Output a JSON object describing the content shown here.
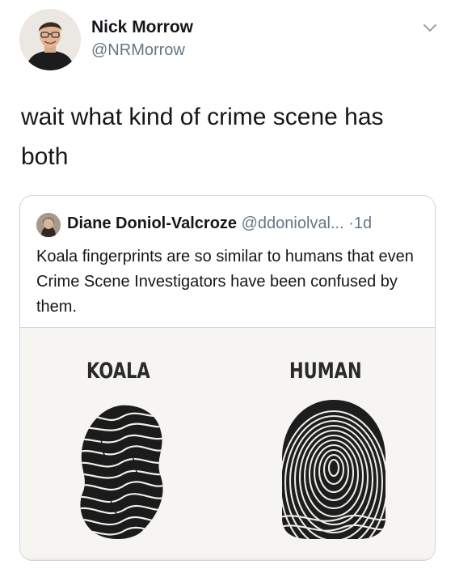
{
  "tweet": {
    "author": {
      "display_name": "Nick Morrow",
      "handle": "@NRMorrow",
      "avatar_icon": "profile-photo"
    },
    "menu_icon": "chevron-down-icon",
    "text": "wait what kind of crime scene has both"
  },
  "quoted_tweet": {
    "author": {
      "display_name": "Diane Doniol-Valcroze",
      "handle": "@ddoniolval...",
      "avatar_icon": "profile-photo"
    },
    "separator": "·",
    "time_ago": "1d",
    "text": "Koala fingerprints are so similar to humans that even Crime Scene Investigators have been confused by them.",
    "image": {
      "labels": {
        "left": "KOALA",
        "right": "HUMAN"
      }
    }
  },
  "colors": {
    "text_primary": "#14171a",
    "text_secondary": "#657786",
    "border": "#ccd6dd"
  }
}
